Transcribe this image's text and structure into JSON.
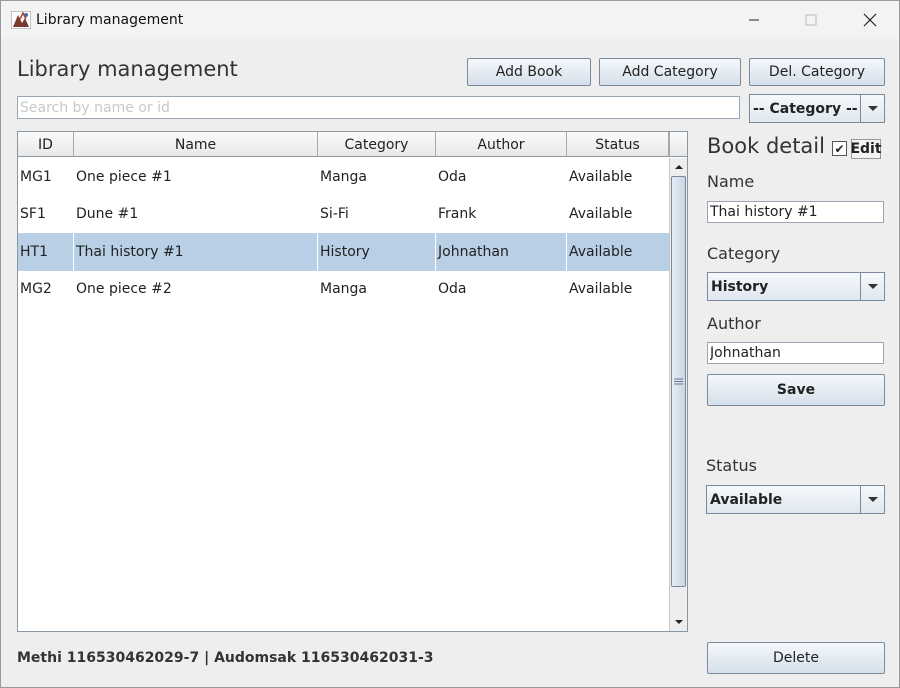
{
  "window": {
    "title": "Library management",
    "controls": {
      "minimize": "minimize-icon",
      "maximize": "maximize-icon",
      "close": "close-icon"
    }
  },
  "header": {
    "title": "Library management",
    "buttons": {
      "add_book": "Add Book",
      "add_category": "Add Category",
      "del_category": "Del. Category"
    }
  },
  "search": {
    "placeholder": "Search by name or id",
    "value": ""
  },
  "category_filter": {
    "selected": "-- Category --"
  },
  "table": {
    "columns": [
      "ID",
      "Name",
      "Category",
      "Author",
      "Status"
    ],
    "rows": [
      [
        "MG1",
        "One piece #1",
        "Manga",
        "Oda",
        "Available"
      ],
      [
        "SF1",
        "Dune #1",
        "Si-Fi",
        "Frank",
        "Available"
      ],
      [
        "HT1",
        "Thai history #1",
        "History",
        "Johnathan",
        "Available"
      ],
      [
        "MG2",
        "One piece #2",
        "Manga",
        "Oda",
        "Available"
      ]
    ],
    "selected_row_index": 2
  },
  "detail": {
    "title": "Book detail",
    "edit_label": "Edit",
    "edit_checked": true,
    "name_label": "Name",
    "name_value": "Thai history #1",
    "category_label": "Category",
    "category_value": "History",
    "author_label": "Author",
    "author_value": "Johnathan",
    "save_label": "Save",
    "status_label": "Status",
    "status_value": "Available",
    "delete_label": "Delete"
  },
  "footer": {
    "credits": "Methi 116530462029-7 | Audomsak 116530462031-3"
  },
  "colors": {
    "selection": "#b8cfe5",
    "window_bg": "#eeeeee",
    "button_border": "#7a8a9c"
  }
}
